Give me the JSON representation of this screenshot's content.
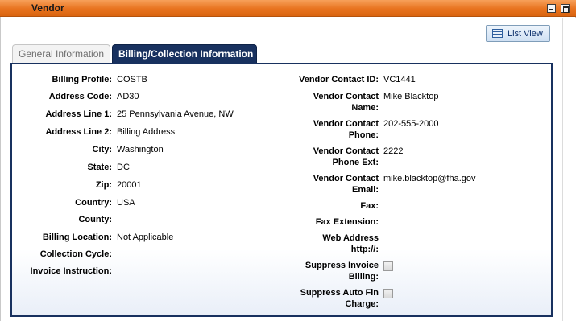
{
  "window": {
    "title": "Vendor"
  },
  "toolbar": {
    "list_view_label": "List View",
    "list_view_icon": "list-view-icon"
  },
  "tabs": [
    {
      "label": "General Information",
      "active": false
    },
    {
      "label": "Billing/Collection Information",
      "active": true
    }
  ],
  "billing": {
    "billing_profile": {
      "label": "Billing Profile:",
      "value": "COSTB"
    },
    "address_code": {
      "label": "Address Code:",
      "value": "AD30"
    },
    "address_line_1": {
      "label": "Address Line 1:",
      "value": "25 Pennsylvania Avenue, NW"
    },
    "address_line_2": {
      "label": "Address Line 2:",
      "value": "Billing Address"
    },
    "city": {
      "label": "City:",
      "value": "Washington"
    },
    "state": {
      "label": "State:",
      "value": "DC"
    },
    "zip": {
      "label": "Zip:",
      "value": "20001"
    },
    "country": {
      "label": "Country:",
      "value": "USA"
    },
    "county": {
      "label": "County:",
      "value": ""
    },
    "billing_location": {
      "label": "Billing Location:",
      "value": "Not Applicable"
    },
    "collection_cycle": {
      "label": "Collection Cycle:",
      "value": ""
    },
    "invoice_instruction": {
      "label": "Invoice Instruction:",
      "value": ""
    }
  },
  "vendor_contact": {
    "id": {
      "label": "Vendor Contact ID:",
      "value": "VC1441"
    },
    "name": {
      "label_line1": "Vendor Contact",
      "label_line2": "Name:",
      "value": "Mike Blacktop"
    },
    "phone": {
      "label_line1": "Vendor Contact",
      "label_line2": "Phone:",
      "value": "202-555-2000"
    },
    "phone_ext": {
      "label_line1": "Vendor Contact",
      "label_line2": "Phone Ext:",
      "value": "2222"
    },
    "email": {
      "label_line1": "Vendor Contact",
      "label_line2": "Email:",
      "value": "mike.blacktop@fha.gov"
    },
    "fax": {
      "label": "Fax:",
      "value": ""
    },
    "fax_extension": {
      "label": "Fax Extension:",
      "value": ""
    },
    "web_address": {
      "label_line1": "Web Address",
      "label_line2": "http://:",
      "value": ""
    },
    "suppress_invoice_billing": {
      "label_line1": "Suppress Invoice",
      "label_line2": "Billing:",
      "checked": false
    },
    "suppress_auto_fin_charge": {
      "label_line1": "Suppress Auto Fin",
      "label_line2": "Charge:",
      "checked": false
    }
  }
}
